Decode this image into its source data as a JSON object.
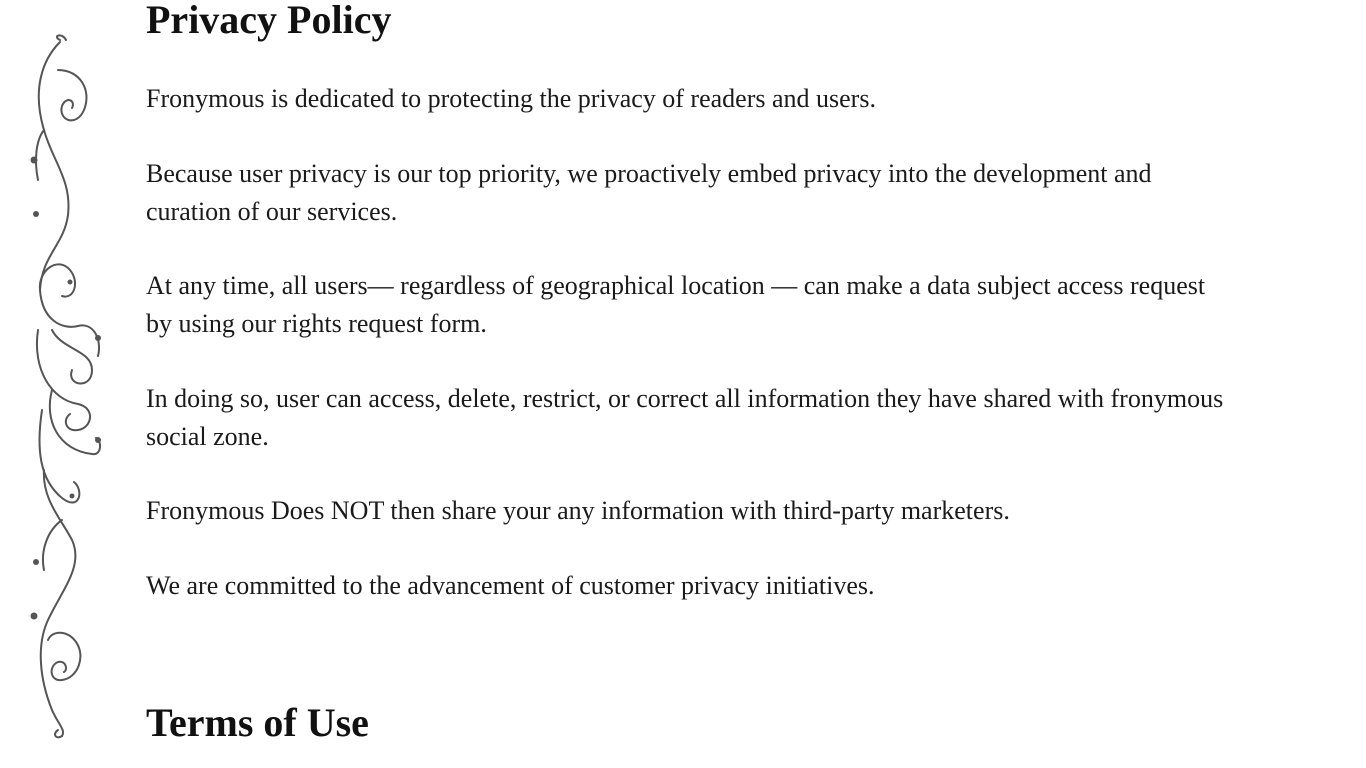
{
  "privacy": {
    "heading": "Privacy Policy",
    "paragraphs": [
      "Fronymous is dedicated to protecting the privacy of readers and users.",
      "Because user privacy is our top priority, we proactively embed privacy into the development and curation of our services.",
      "At any time, all users— regardless of geographical location — can make a data subject access request by using our rights request form.",
      "In doing so, user can access, delete, restrict, or correct all information they have shared with fronymous social zone.",
      "Fronymous Does NOT then share your any information with third-party marketers.",
      "We are committed to the advancement of customer privacy initiatives."
    ]
  },
  "terms": {
    "heading": "Terms of Use"
  },
  "decoration": {
    "icon": "flourish-vine-icon",
    "color": "#555555"
  }
}
